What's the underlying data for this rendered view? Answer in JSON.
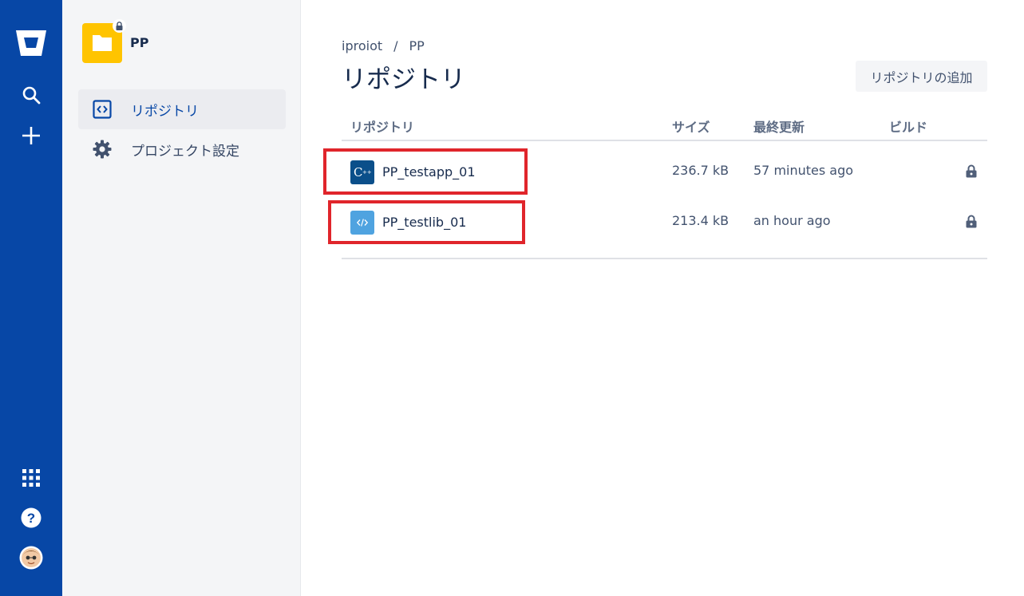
{
  "global_nav": {
    "icons": [
      "bitbucket-logo-icon",
      "search-icon",
      "plus-icon",
      "app-switcher-icon",
      "help-icon",
      "user-avatar"
    ]
  },
  "project": {
    "name": "PP",
    "nav": [
      {
        "label": "リポジトリ",
        "icon": "code-icon",
        "active": true
      },
      {
        "label": "プロジェクト設定",
        "icon": "gear-icon",
        "active": false
      }
    ]
  },
  "breadcrumb": {
    "items": [
      "iproiot",
      "PP"
    ],
    "separator": "/"
  },
  "page": {
    "title": "リポジトリ",
    "add_button": "リポジトリの追加"
  },
  "table": {
    "headers": {
      "name": "リポジトリ",
      "size": "サイズ",
      "updated": "最終更新",
      "build": "ビルド"
    },
    "rows": [
      {
        "name": "PP_testapp_01",
        "size": "236.7 kB",
        "updated": "57 minutes ago",
        "icon": "cpp-language-icon",
        "private": true
      },
      {
        "name": "PP_testlib_01",
        "size": "213.4 kB",
        "updated": "an hour ago",
        "icon": "code-language-icon",
        "private": true
      }
    ]
  },
  "colors": {
    "nav_blue": "#0747a6",
    "project_yellow": "#ffc400",
    "highlight_red": "#e0252b"
  }
}
